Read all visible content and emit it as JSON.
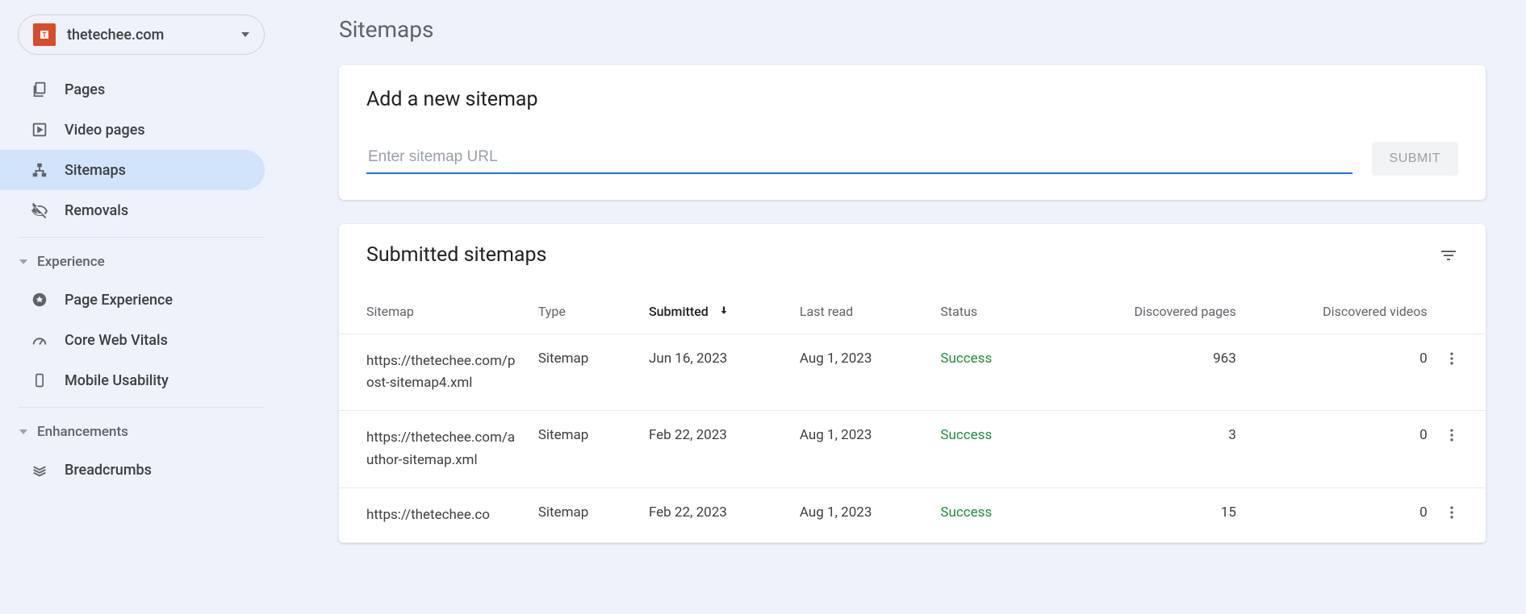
{
  "property": {
    "name": "thetechee.com"
  },
  "sidebar": {
    "items": [
      {
        "label": "Pages"
      },
      {
        "label": "Video pages"
      },
      {
        "label": "Sitemaps"
      },
      {
        "label": "Removals"
      }
    ],
    "section_experience": "Experience",
    "exp_items": [
      {
        "label": "Page Experience"
      },
      {
        "label": "Core Web Vitals"
      },
      {
        "label": "Mobile Usability"
      }
    ],
    "section_enhancements": "Enhancements",
    "enh_items": [
      {
        "label": "Breadcrumbs"
      }
    ]
  },
  "page": {
    "title": "Sitemaps",
    "add_card_title": "Add a new sitemap",
    "input_placeholder": "Enter sitemap URL",
    "submit_label": "SUBMIT",
    "table_title": "Submitted sitemaps",
    "columns": {
      "sitemap": "Sitemap",
      "type": "Type",
      "submitted": "Submitted",
      "last_read": "Last read",
      "status": "Status",
      "discovered_pages": "Discovered pages",
      "discovered_videos": "Discovered videos"
    },
    "rows": [
      {
        "url": "https://thetechee.com/post-sitemap4.xml",
        "type": "Sitemap",
        "submitted": "Jun 16, 2023",
        "last_read": "Aug 1, 2023",
        "status": "Success",
        "pages": "963",
        "videos": "0"
      },
      {
        "url": "https://thetechee.com/author-sitemap.xml",
        "type": "Sitemap",
        "submitted": "Feb 22, 2023",
        "last_read": "Aug 1, 2023",
        "status": "Success",
        "pages": "3",
        "videos": "0"
      },
      {
        "url": "https://thetechee.co",
        "type": "Sitemap",
        "submitted": "Feb 22, 2023",
        "last_read": "Aug 1, 2023",
        "status": "Success",
        "pages": "15",
        "videos": "0"
      }
    ]
  }
}
